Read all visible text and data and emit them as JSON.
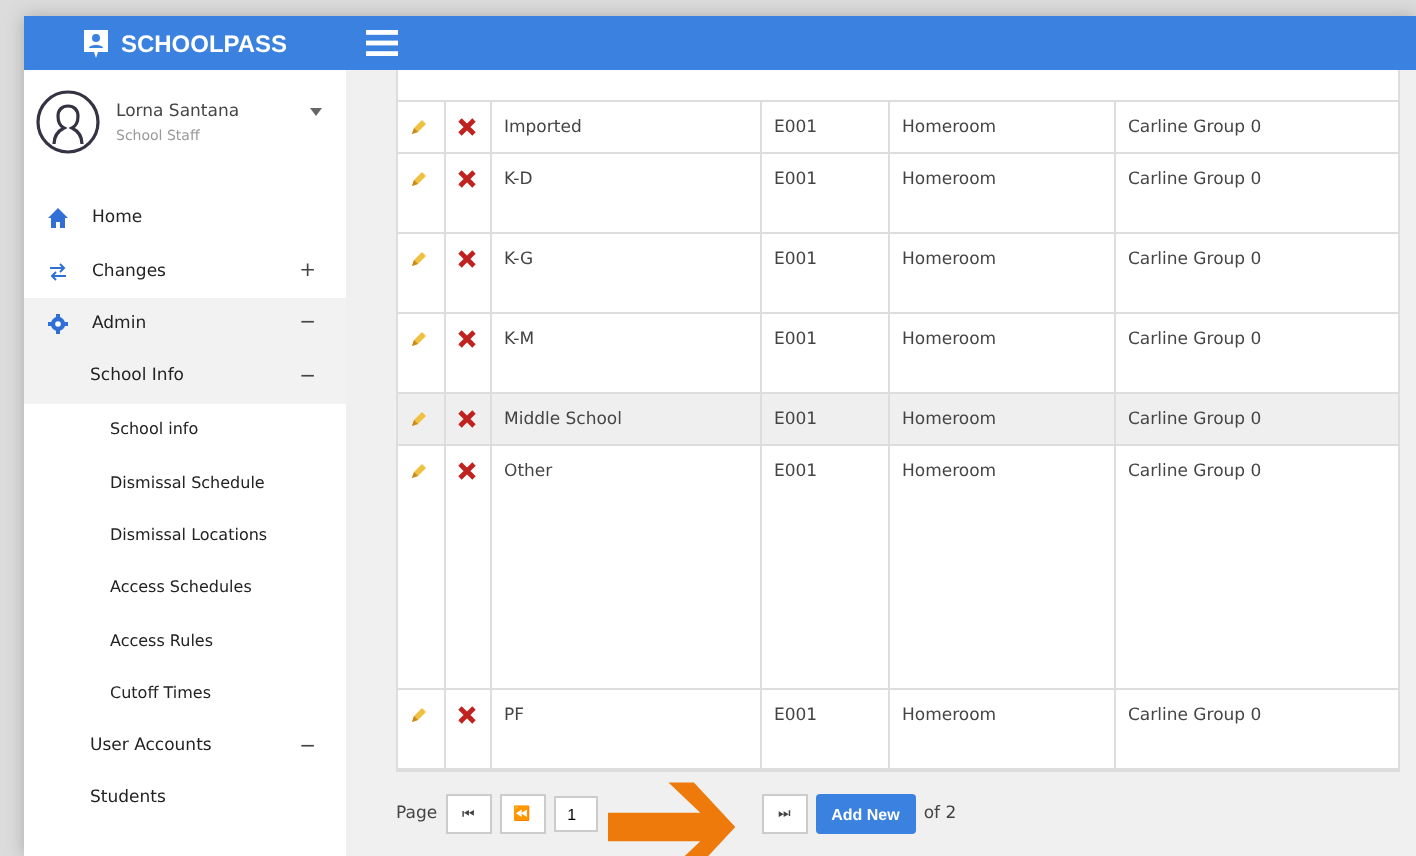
{
  "brand": "SCHOOLPASS",
  "user": {
    "name": "Lorna Santana",
    "role": "School Staff"
  },
  "nav": [
    {
      "kind": "top",
      "label": "Home",
      "selected": false
    },
    {
      "kind": "top",
      "label": "Changes",
      "toggle": "+",
      "selected": false
    },
    {
      "kind": "top",
      "label": "Admin",
      "toggle": "−",
      "selected": true
    },
    {
      "kind": "sub",
      "label": "School Info",
      "toggle": "−",
      "selected": true
    },
    {
      "kind": "leaf",
      "label": "School info",
      "selected": false
    },
    {
      "kind": "leaf",
      "label": "Dismissal Schedule",
      "selected": false
    },
    {
      "kind": "leaf",
      "label": "Dismissal Locations",
      "selected": false
    },
    {
      "kind": "leaf",
      "label": "Access Schedules",
      "selected": false
    },
    {
      "kind": "leaf",
      "label": "Access Rules",
      "selected": false
    },
    {
      "kind": "leaf",
      "label": "Cutoff Times",
      "selected": false
    },
    {
      "kind": "sub",
      "label": "User Accounts",
      "toggle": "−",
      "selected": false
    },
    {
      "kind": "sub",
      "label": "Students",
      "selected": false
    }
  ],
  "table": {
    "rows": [
      {
        "name": "Imported",
        "code": "E001",
        "type": "Homeroom",
        "group": "Carline Group 0",
        "selected": false
      },
      {
        "name": "K-D",
        "code": "E001",
        "type": "Homeroom",
        "group": "Carline Group 0",
        "selected": false
      },
      {
        "name": "K-G",
        "code": "E001",
        "type": "Homeroom",
        "group": "Carline Group 0",
        "selected": false
      },
      {
        "name": "K-M",
        "code": "E001",
        "type": "Homeroom",
        "group": "Carline Group 0",
        "selected": false
      },
      {
        "name": "Middle School",
        "code": "E001",
        "type": "Homeroom",
        "group": "Carline Group 0",
        "selected": true
      },
      {
        "name": "Other",
        "code": "E001",
        "type": "Homeroom",
        "group": "Carline Group 0",
        "selected": false
      },
      {
        "name": "PF",
        "code": "E001",
        "type": "Homeroom",
        "group": "Carline Group 0",
        "selected": false
      }
    ]
  },
  "pager": {
    "label": "Page",
    "first": "⏮",
    "prev": "⏪",
    "page": "1",
    "last": "⏭",
    "add": "Add New",
    "total": "of 2"
  }
}
